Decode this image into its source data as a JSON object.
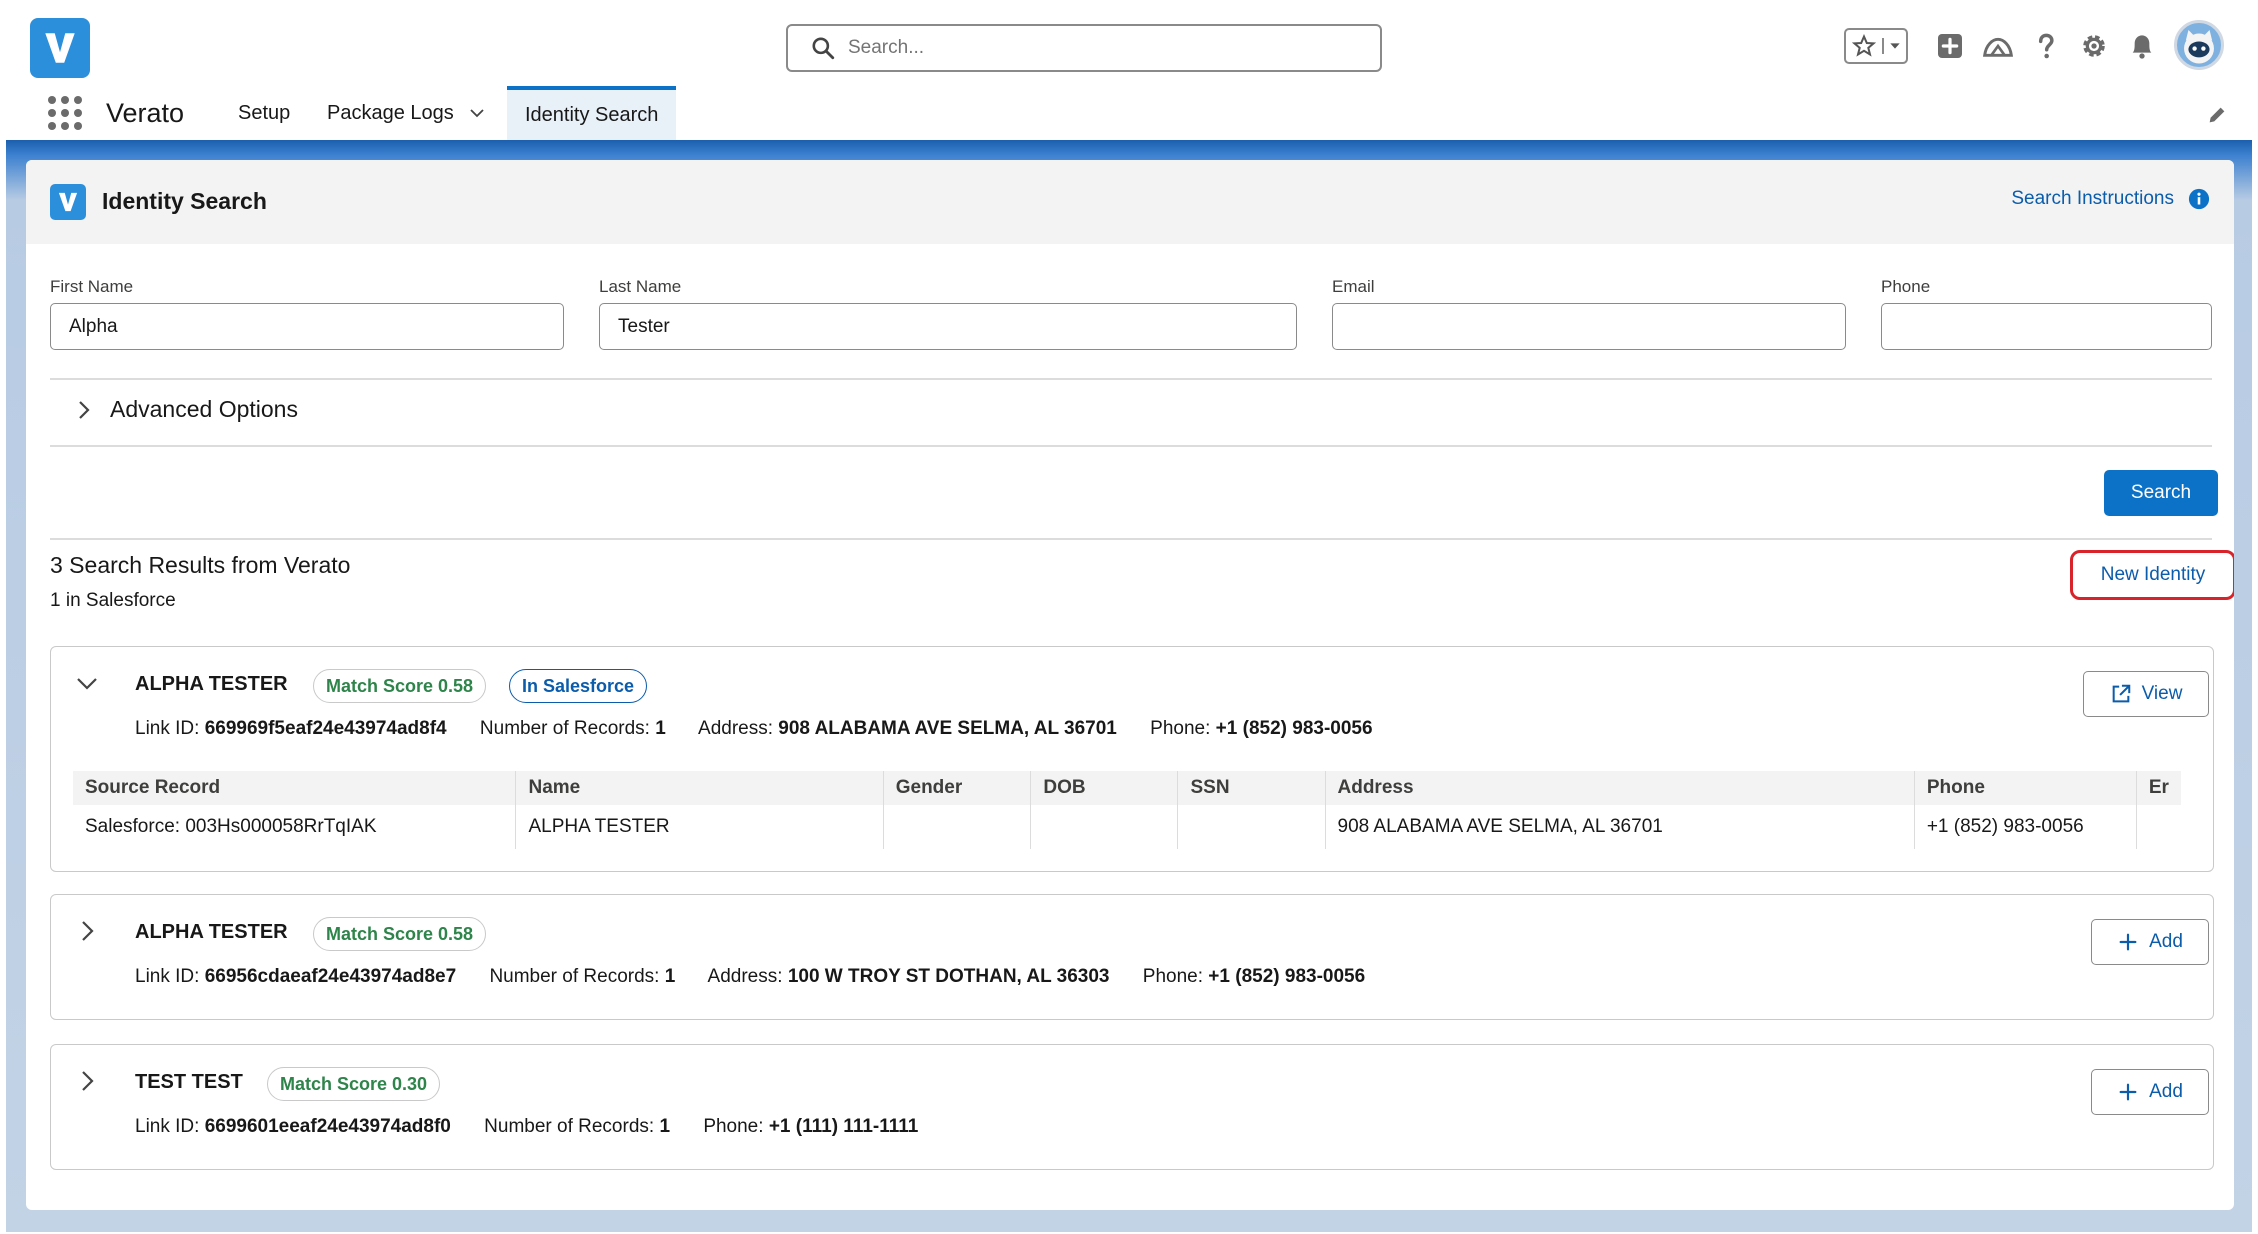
{
  "global_header": {
    "search_placeholder": "Search...",
    "utility_icons": [
      "favorites-star-icon",
      "favorites-dropdown-icon",
      "global-actions-icon",
      "trailhead-icon",
      "help-icon",
      "setup-gear-icon",
      "notifications-bell-icon"
    ]
  },
  "nav": {
    "app_name": "Verato",
    "items": [
      {
        "label": "Setup"
      },
      {
        "label": "Package Logs"
      },
      {
        "label": "Identity Search"
      }
    ]
  },
  "card": {
    "title": "Identity Search",
    "instructions_link": "Search Instructions"
  },
  "form": {
    "first_name": {
      "label": "First Name",
      "value": "Alpha"
    },
    "last_name": {
      "label": "Last Name",
      "value": "Tester"
    },
    "email": {
      "label": "Email",
      "value": ""
    },
    "phone": {
      "label": "Phone",
      "value": ""
    },
    "advanced_options": "Advanced Options",
    "search_button": "Search"
  },
  "results": {
    "title": "3 Search Results from Verato",
    "subtitle": "1 in Salesforce",
    "new_identity_button": "New Identity",
    "items": [
      {
        "name": "ALPHA TESTER",
        "match_score": "Match Score 0.58",
        "badge": "In Salesforce",
        "link_id_label": "Link ID:",
        "link_id": "669969f5eaf24e43974ad8f4",
        "records_label": "Number of Records:",
        "records": "1",
        "address_label": "Address:",
        "address": "908 ALABAMA AVE SELMA, AL 36701",
        "phone_label": "Phone:",
        "phone": "+1 (852) 983-0056",
        "action": "View",
        "table": {
          "headers": [
            "Source Record",
            "Name",
            "Gender",
            "DOB",
            "SSN",
            "Address",
            "Phone",
            "Er"
          ],
          "rows": [
            [
              "Salesforce: 003Hs000058RrTqIAK",
              "ALPHA TESTER",
              "",
              "",
              "",
              "908 ALABAMA AVE SELMA, AL 36701",
              "+1 (852) 983-0056",
              ""
            ]
          ]
        }
      },
      {
        "name": "ALPHA TESTER",
        "match_score": "Match Score 0.58",
        "link_id_label": "Link ID:",
        "link_id": "66956cdaeaf24e43974ad8e7",
        "records_label": "Number of Records:",
        "records": "1",
        "address_label": "Address:",
        "address": "100 W TROY ST DOTHAN, AL 36303",
        "phone_label": "Phone:",
        "phone": "+1 (852) 983-0056",
        "action": "Add"
      },
      {
        "name": "TEST TEST",
        "match_score": "Match Score 0.30",
        "link_id_label": "Link ID:",
        "link_id": "6699601eeaf24e43974ad8f0",
        "records_label": "Number of Records:",
        "records": "1",
        "phone_label": "Phone:",
        "phone": "+1 (111) 111-1111",
        "action": "Add"
      }
    ]
  },
  "colors": {
    "brand_blue": "#0b72c7",
    "link_blue": "#0b5cab",
    "match_green": "#2e844a",
    "highlight_red": "#d8232a"
  }
}
